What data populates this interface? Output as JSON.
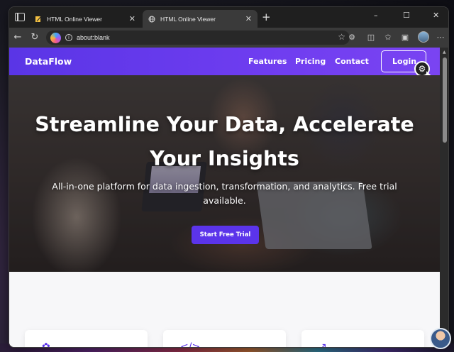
{
  "browser": {
    "tabs": [
      {
        "label": "HTML Online Viewer",
        "active": false,
        "favicon": "file-edit-icon"
      },
      {
        "label": "HTML Online Viewer",
        "active": true,
        "favicon": "globe-icon"
      }
    ],
    "new_tab_symbol": "+",
    "window_controls": {
      "minimize": "–",
      "maximize": "☐",
      "close": "✕"
    },
    "address": {
      "url": "about:blank"
    },
    "nav": {
      "back": "←",
      "refresh": "↻"
    }
  },
  "site": {
    "brand": "DataFlow",
    "nav_links": [
      "Features",
      "Pricing",
      "Contact"
    ],
    "login_label": "Login",
    "hero": {
      "title": "Streamline Your Data, Accelerate Your Insights",
      "subtitle": "All-in-one platform for data ingestion, transformation, and analytics. Free trial available.",
      "cta_label": "Start Free Trial"
    }
  },
  "colors": {
    "brand_purple": "#5b34ea",
    "nav_gradient_end": "#7a44f2",
    "browser_chrome": "#1f1f1f"
  }
}
